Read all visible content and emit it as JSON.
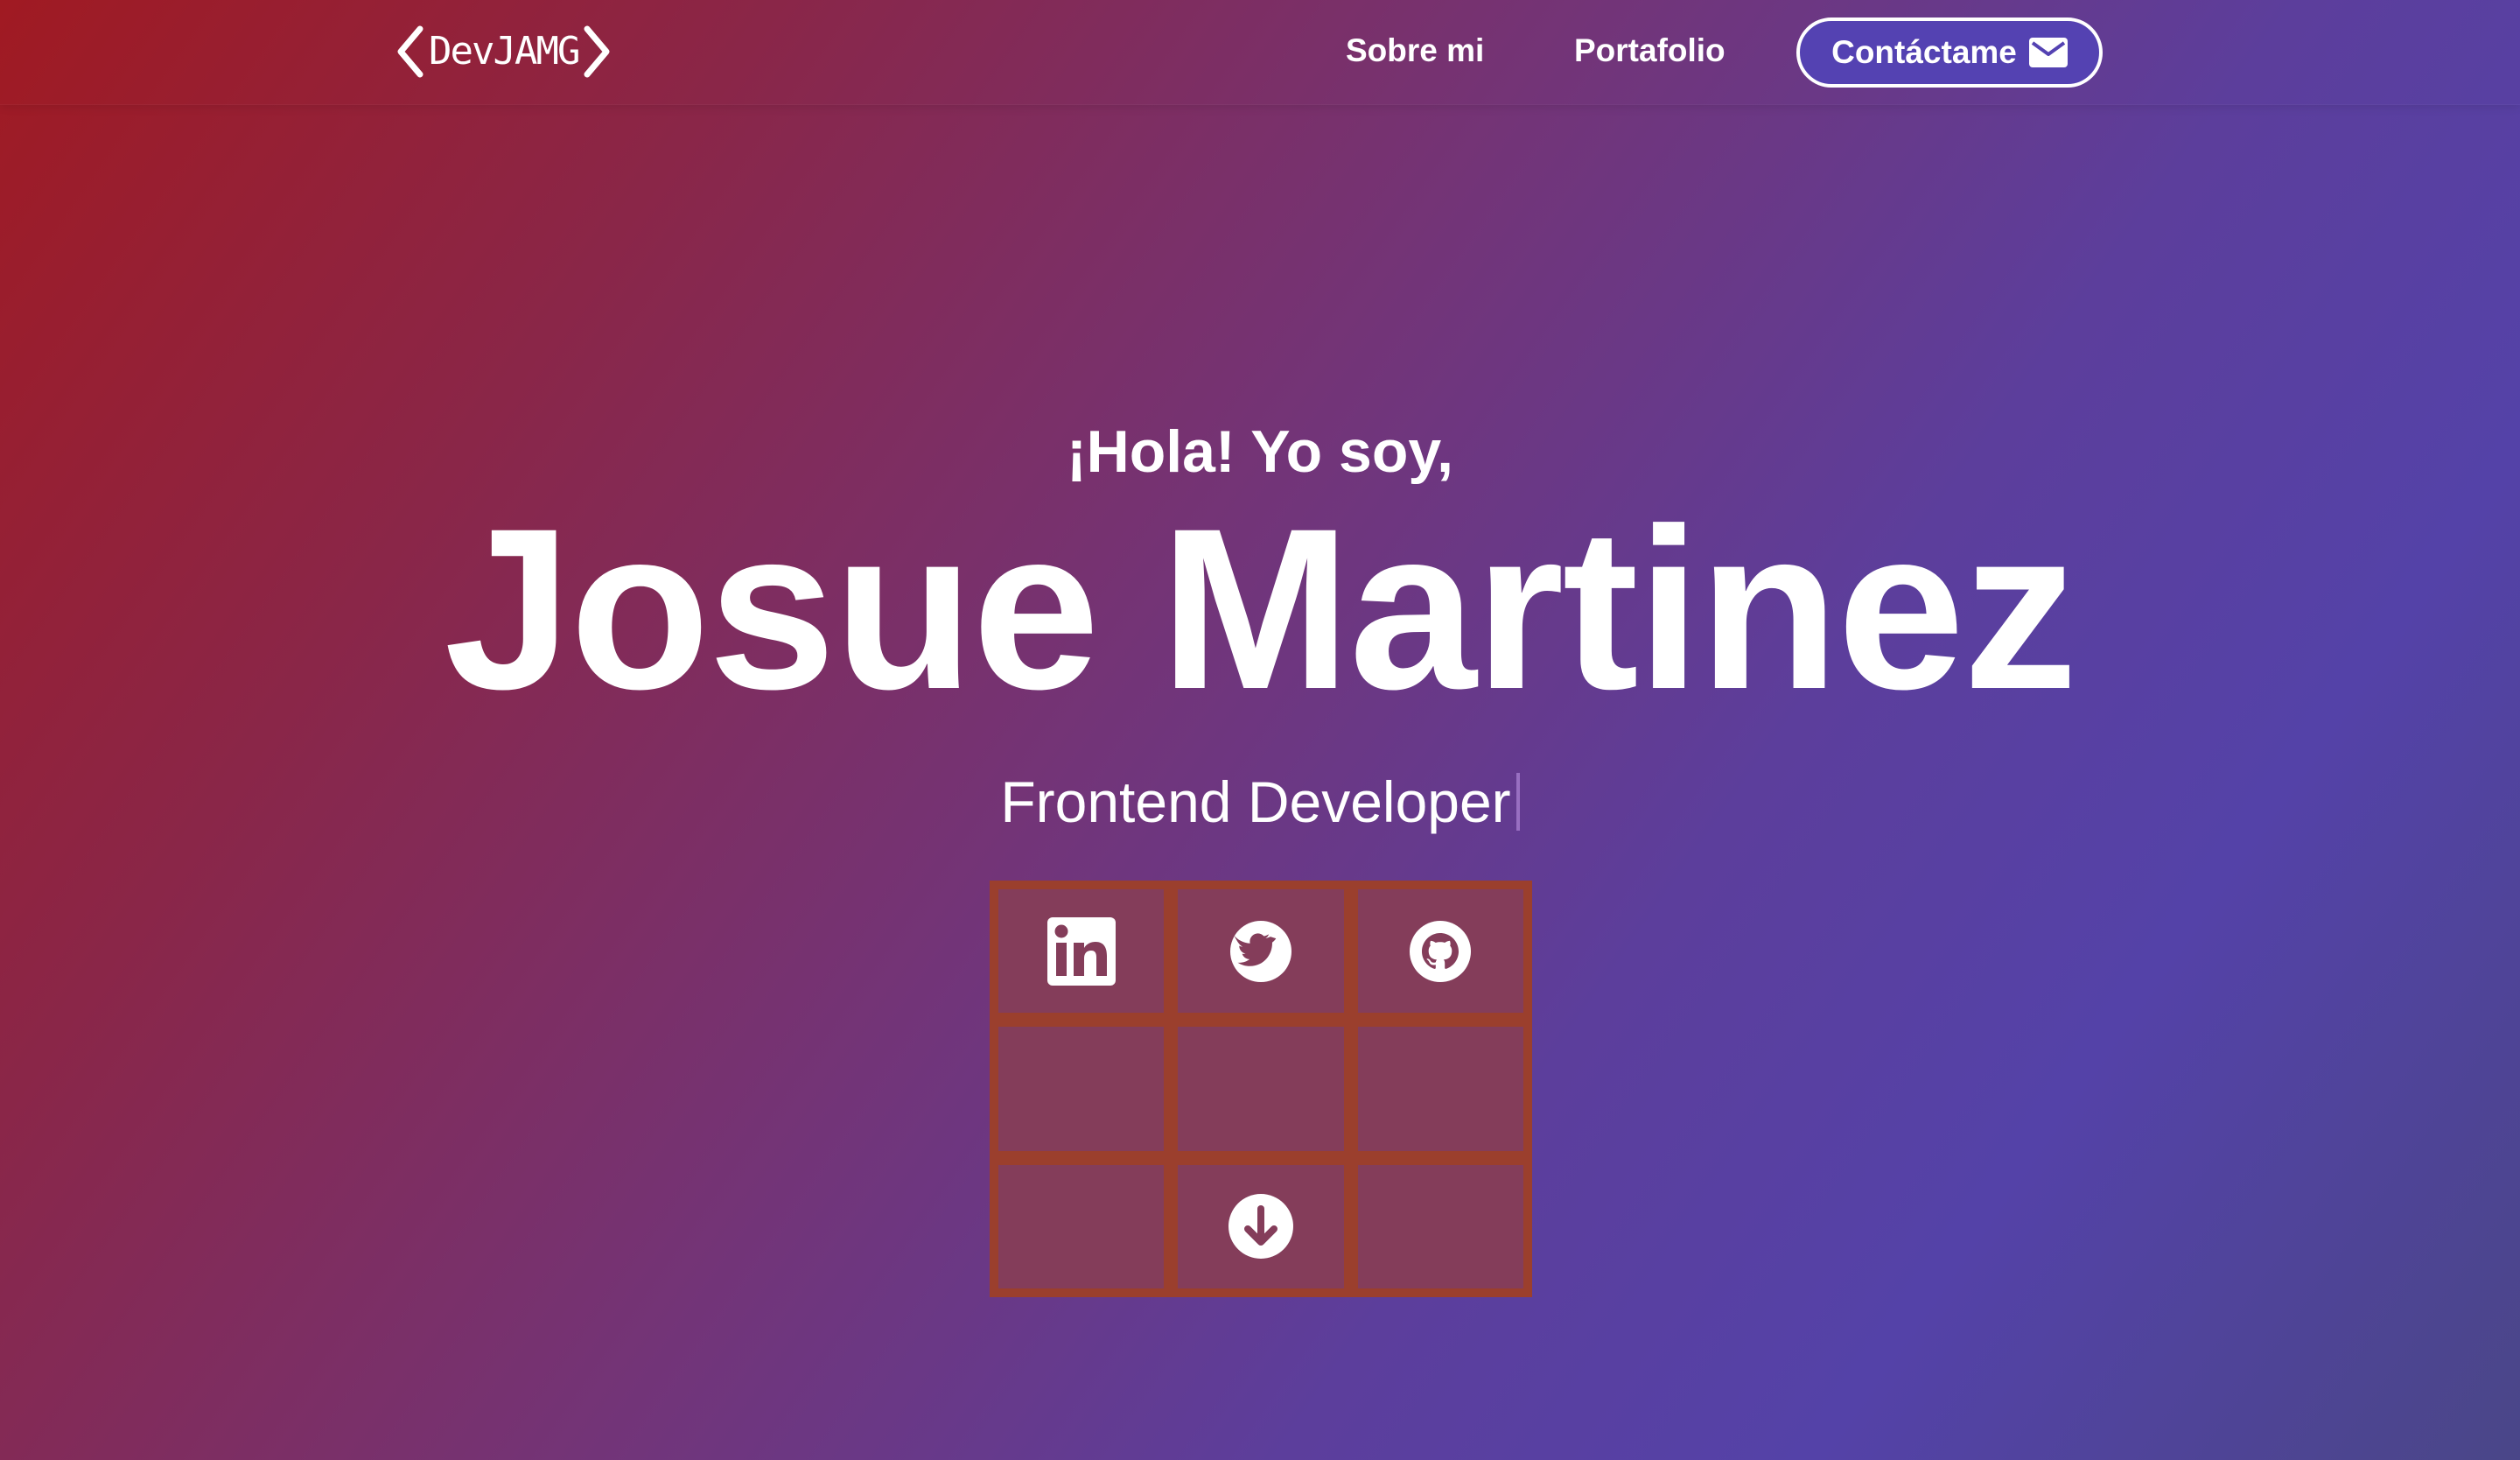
{
  "nav": {
    "logo_text": "DevJAMG",
    "links": [
      {
        "label": "Sobre mi"
      },
      {
        "label": "Portafolio"
      }
    ],
    "contact_label": "Contáctame",
    "contact_icon": "envelope-icon"
  },
  "hero": {
    "greeting": "¡Hola! Yo soy,",
    "name": "Josue Martinez",
    "role": "Frontend Developer"
  },
  "social": {
    "icons": [
      "linkedin-icon",
      "twitter-icon",
      "github-icon",
      "arrow-down-circle-icon"
    ]
  },
  "colors": {
    "contact_bg": "#5442b2",
    "grid_border": "#9b3f2d",
    "grid_cell": "#843d5a"
  }
}
